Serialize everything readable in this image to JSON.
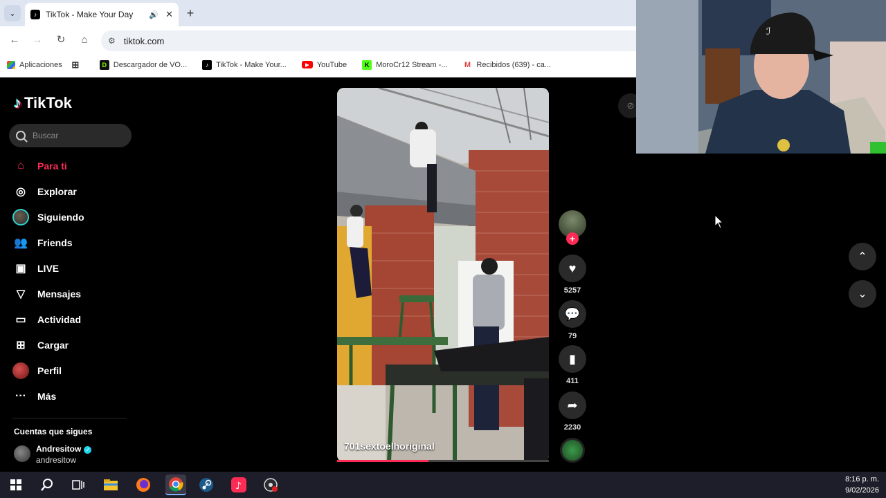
{
  "browser": {
    "tab": {
      "title": "TikTok - Make Your Day"
    },
    "address": {
      "url": "tiktok.com"
    },
    "bookmarks": [
      {
        "label": "Aplicaciones",
        "icon": "apps-grid-icon"
      },
      {
        "label": "Descargador de VO...",
        "icon": "download-icon"
      },
      {
        "label": "TikTok - Make Your...",
        "icon": "tiktok-icon"
      },
      {
        "label": "YouTube",
        "icon": "youtube-icon"
      },
      {
        "label": "MoroCr12 Stream -...",
        "icon": "kick-icon"
      },
      {
        "label": "Recibidos (639) - ca...",
        "icon": "gmail-icon"
      }
    ]
  },
  "tiktok": {
    "logo": "TikTok",
    "search_placeholder": "Buscar",
    "nav": [
      {
        "label": "Para ti",
        "icon": "home-icon",
        "active": true
      },
      {
        "label": "Explorar",
        "icon": "compass-icon"
      },
      {
        "label": "Siguiendo",
        "icon": "following-avatar-icon"
      },
      {
        "label": "Friends",
        "icon": "friends-icon"
      },
      {
        "label": "LIVE",
        "icon": "live-icon"
      },
      {
        "label": "Mensajes",
        "icon": "send-icon"
      },
      {
        "label": "Actividad",
        "icon": "activity-icon"
      },
      {
        "label": "Cargar",
        "icon": "upload-icon"
      },
      {
        "label": "Perfil",
        "icon": "profile-avatar-icon"
      },
      {
        "label": "Más",
        "icon": "more-icon"
      }
    ],
    "following_title": "Cuentas que sigues",
    "following": [
      {
        "name": "Andresitow",
        "username": "andresitow",
        "verified": true
      }
    ],
    "video": {
      "caption": "701sextoelhoriginal",
      "progress": 0.43
    },
    "actions": {
      "likes": "5257",
      "comments": "79",
      "saves": "411",
      "shares": "2230"
    }
  },
  "taskbar": {
    "time": "8:16 p. m.",
    "date": "9/02/2026"
  },
  "colors": {
    "accent": "#fe2c55",
    "tiktok_cyan": "#25f4ee"
  }
}
